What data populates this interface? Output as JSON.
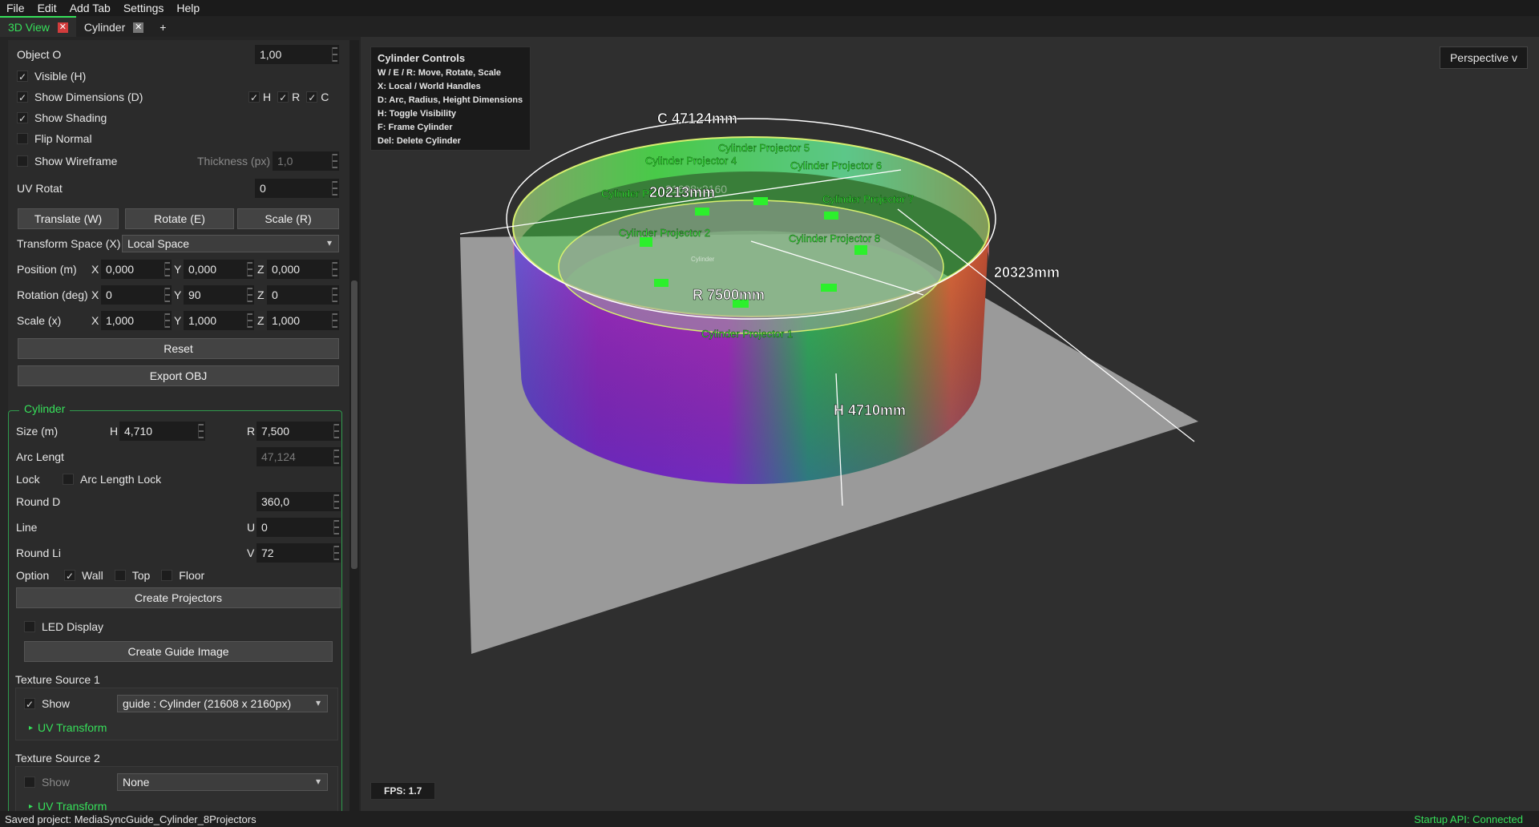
{
  "menu": [
    "File",
    "Edit",
    "Add Tab",
    "Settings",
    "Help"
  ],
  "tabs": [
    {
      "label": "3D View"
    },
    {
      "label": "Cylinder"
    },
    {
      "label": "+"
    }
  ],
  "tab_close": "✕",
  "object": {
    "opacity_label": "Object O",
    "opacity_value": "1,00",
    "visible_label": "Visible (H)",
    "dims_label": "Show Dimensions (D)",
    "dim_h": "H",
    "dim_r": "R",
    "dim_c": "C",
    "shading_label": "Show Shading",
    "flip_label": "Flip Normal",
    "wire_label": "Show Wireframe",
    "thick_label": "Thickness (px)",
    "thick_value": "1,0",
    "uvrot_label": "UV Rotat",
    "uvrot_value": "0",
    "translate_btn": "Translate (W)",
    "rotate_btn": "Rotate (E)",
    "scale_btn": "Scale (R)",
    "space_label": "Transform Space (X)",
    "space_value": "Local Space",
    "pos_label": "Position (m)",
    "pos": [
      "0,000",
      "0,000",
      "0,000"
    ],
    "rot_label": "Rotation (deg)",
    "rot": [
      "0",
      "90",
      "0"
    ],
    "scl_label": "Scale (x)",
    "scl": [
      "1,000",
      "1,000",
      "1,000"
    ],
    "ax_x": "X",
    "ax_y": "Y",
    "ax_z": "Z",
    "reset_btn": "Reset",
    "export_btn": "Export OBJ"
  },
  "cyl": {
    "title": "Cylinder",
    "size_label": "Size (m)",
    "h_label": "H",
    "h_value": "4,710",
    "r_label": "R",
    "r_value": "7,500",
    "arc_label": "Arc Lengt",
    "arc_value": "47,124",
    "lock_label": "Lock",
    "arclock_label": "Arc Length Lock",
    "round_label": "Round D",
    "round_value": "360,0",
    "line_label": "Line",
    "u_label": "U",
    "u_value": "0",
    "roundli_label": "Round Li",
    "v_label": "V",
    "v_value": "72",
    "option_label": "Option",
    "wall_label": "Wall",
    "top_label": "Top",
    "floor_label": "Floor",
    "create_proj_btn": "Create Projectors",
    "led_label": "LED Display",
    "guide_btn": "Create Guide Image",
    "tex1_label": "Texture Source 1",
    "tex1_show": "Show",
    "tex1_value": "guide : Cylinder (21608 x 2160px)",
    "uv_label": "UV Transform",
    "tex2_label": "Texture Source 2",
    "tex2_show": "Show",
    "tex2_value": "None",
    "uv2_label": "UV Transform"
  },
  "overlay": {
    "title": "Cylinder Controls",
    "lines": [
      "W / E / R: Move, Rotate, Scale",
      "X: Local / World Handles",
      "D: Arc, Radius, Height Dimensions",
      "H: Toggle Visibility",
      "F: Frame Cylinder",
      "Del: Delete Cylinder"
    ]
  },
  "perspective": "Perspective v",
  "fps": "FPS: 1.7",
  "scene": {
    "circ": "C 47124mm",
    "diam": "20213mm",
    "radius": "R 7500mm",
    "height": "H 4710mm",
    "diag": "20323mm",
    "tex_res": "21608x2160",
    "tex_name": "Cylinder",
    "projectors": [
      "Cylinder Projector 1",
      "Cylinder Projector 2",
      "Cylinder Projector 3",
      "Cylinder Projector 4",
      "Cylinder Projector 5",
      "Cylinder Projector 6",
      "Cylinder Projector 7",
      "Cylinder Projector 8"
    ],
    "proj3_visible": "Cylinder Pro"
  },
  "status": {
    "left": "Saved project: MediaSyncGuide_Cylinder_8Projectors",
    "right": "Startup API: Connected"
  },
  "colors": {
    "accent": "#36e05a",
    "close": "#d23c3c"
  }
}
